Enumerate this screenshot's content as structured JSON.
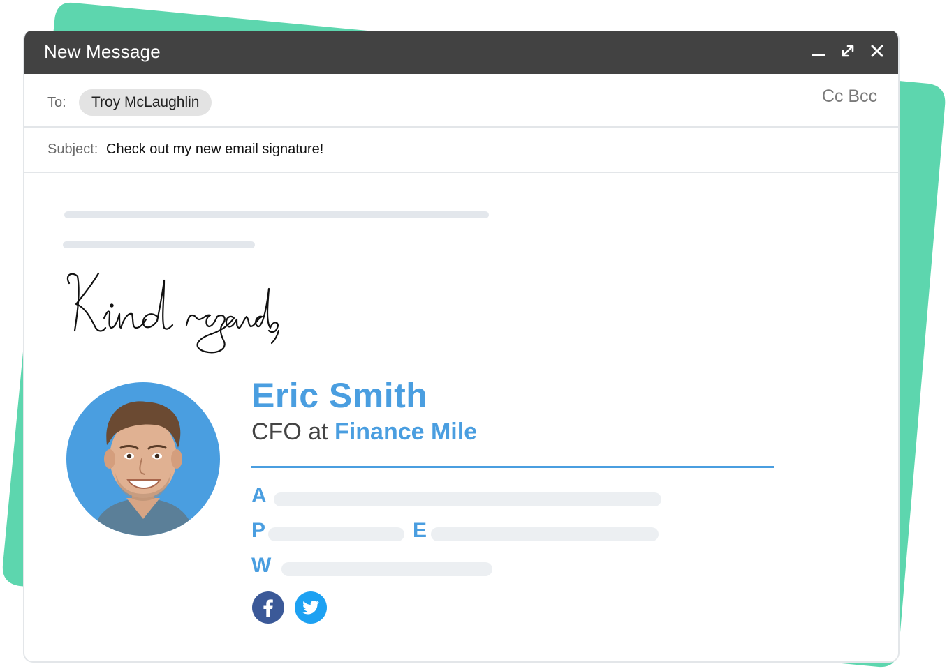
{
  "window": {
    "title": "New Message",
    "controls": [
      "minimize-icon",
      "expand-icon",
      "close-icon"
    ]
  },
  "to": {
    "label": "To:",
    "recipient": "Troy McLaughlin",
    "cc_bcc": "Cc Bcc"
  },
  "subject": {
    "label": "Subject:",
    "value": "Check out my new email signature!"
  },
  "signature": {
    "closing": "Kind regards,",
    "name": "Eric Smith",
    "role": "CFO",
    "at": "at",
    "company": "Finance Mile",
    "info_labels": {
      "address": "A",
      "phone": "P",
      "email": "E",
      "website": "W"
    },
    "social": [
      "facebook-icon",
      "twitter-icon"
    ]
  },
  "colors": {
    "accent": "#4a9ee0",
    "titlebar": "#424242",
    "background_shape": "#5dd6ae",
    "facebook": "#3b5998",
    "twitter": "#1da1f2"
  }
}
